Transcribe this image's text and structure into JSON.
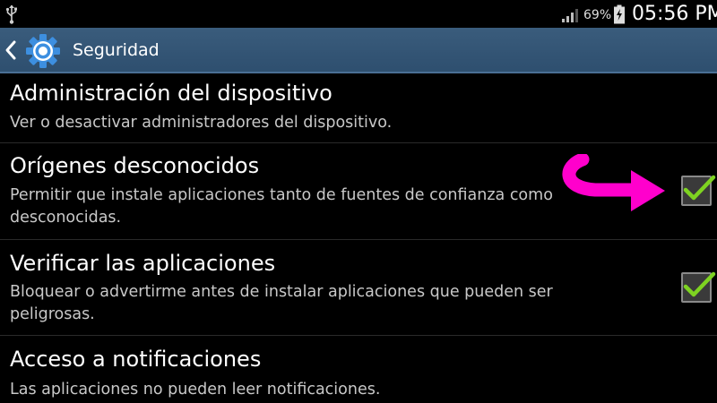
{
  "status_bar": {
    "battery_percent": "69%",
    "time": "05:56 PM",
    "icons": [
      "usb-icon",
      "signal-icon",
      "battery-charging-icon"
    ]
  },
  "action_bar": {
    "title": "Seguridad",
    "icons": [
      "back-icon",
      "settings-gear-icon"
    ],
    "accent_color": "#3a5c7c"
  },
  "settings": [
    {
      "title": "Administración del dispositivo",
      "description": "Ver o desactivar administradores del dispositivo.",
      "has_checkbox": false
    },
    {
      "title": "Orígenes desconocidos",
      "description": "Permitir que instale aplicaciones tanto de fuentes de confianza como desconocidas.",
      "has_checkbox": true,
      "checked": true
    },
    {
      "title": "Verificar las aplicaciones",
      "description": "Bloquear o advertirme antes de instalar aplicaciones que pueden ser peligrosas.",
      "has_checkbox": true,
      "checked": true
    },
    {
      "title": "Acceso a notificaciones",
      "description": "Las aplicaciones no pueden leer notificaciones.",
      "has_checkbox": false
    }
  ],
  "colors": {
    "check_green": "#7ed321",
    "annotation_arrow": "#ff00cc"
  }
}
